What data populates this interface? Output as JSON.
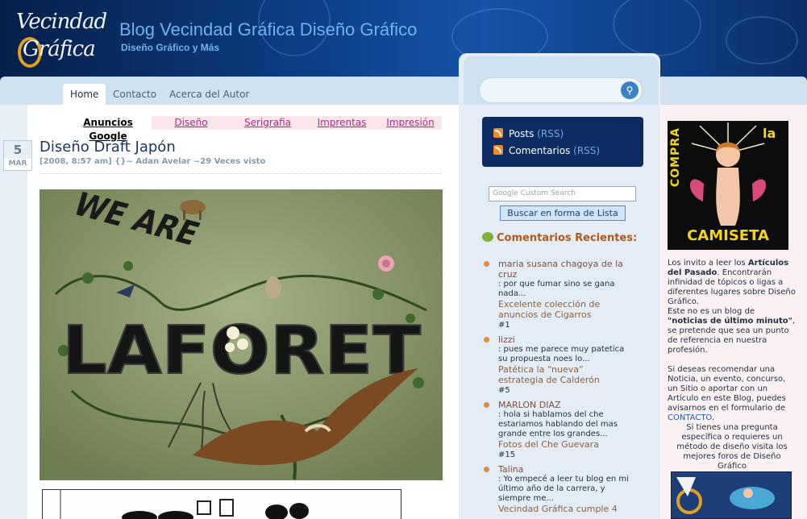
{
  "header": {
    "logo_line1": "Vecindad",
    "logo_line2": "Gráfica",
    "blog_title": "Blog Vecindad Gráfica Diseño Gráfico",
    "blog_subtitle": "Diseño Gráfico y Más"
  },
  "nav": {
    "tabs": [
      {
        "label": "Home"
      },
      {
        "label": "Contacto"
      },
      {
        "label": "Acerca del Autor"
      }
    ]
  },
  "adbar": {
    "links": [
      "Anuncios Google",
      "Diseño",
      "Serigrafia",
      "Imprentas",
      "Impresión"
    ]
  },
  "post": {
    "day": "5",
    "month": "MAR",
    "title": "Diseño Draft Japón",
    "meta": "[2008, 8:57 am] {}~ Adan Avelar ~29 Veces visto",
    "image_text_top": "WE ARE",
    "image_text_main": "LAFORET"
  },
  "sidebar_mid": {
    "rss": {
      "posts_label": "Posts",
      "comments_label": "Comentarios",
      "rss_tag": "(RSS)"
    },
    "search_placeholder": "Google Custom Search",
    "list_button": "Buscar en forma de Lista",
    "comments_title": "Comentarios Recientes:",
    "comments": [
      {
        "author": "maria susana chagoya de la cruz",
        "body": ": por que fumar sino se gana nada...",
        "post": "Excelente colección de anuncios de Cigarros",
        "num": "#1"
      },
      {
        "author": "lizzi",
        "body": ": pues me parece muy patetica su propuesta noes lo...",
        "post": "Patética la “nueva” estrategia de Calderón",
        "num": "#5"
      },
      {
        "author": "MARLON DIAZ",
        "body": ": hola si hablamos del che estariamos hablando del mas grande entre los grandes...",
        "post": "Fotos del Che Guevara",
        "num": "#15"
      },
      {
        "author": "Talina",
        "body": ": Yo empecé a leer tu blog en mi último año de la carrera, y siempre me...",
        "post": "Vecindad Gráfica cumple 4",
        "num": ""
      }
    ]
  },
  "sidebar_right": {
    "promo_compra": "COMPRA",
    "promo_la": "la",
    "promo_camiseta": "CAMISETA",
    "p1a": "Los invito a leer los ",
    "p1b": "Artículos del Pasado",
    "p1c": ". Encontrarán infinidad de tópicos o ligas a diferentes lugares sobre Diseño Gráfico.",
    "p1d": "Este no es un blog de ",
    "p1e": "\"noticias de último minuto\"",
    "p1f": ", se pretende que sea un punto de referencia en nuestra profesión.",
    "p2a": "Si deseas recomendar una Noticia, un evento, concurso, un Sitio o aportar con un Artículo en este Blog, puedes avisarnos en el formulario de ",
    "p2b": "CONTACTO",
    "p2c": ".",
    "p3": "Si tienes una pregunta específica o requieres un método de diseño visita los mejores foros de Diseño Gráfico"
  }
}
